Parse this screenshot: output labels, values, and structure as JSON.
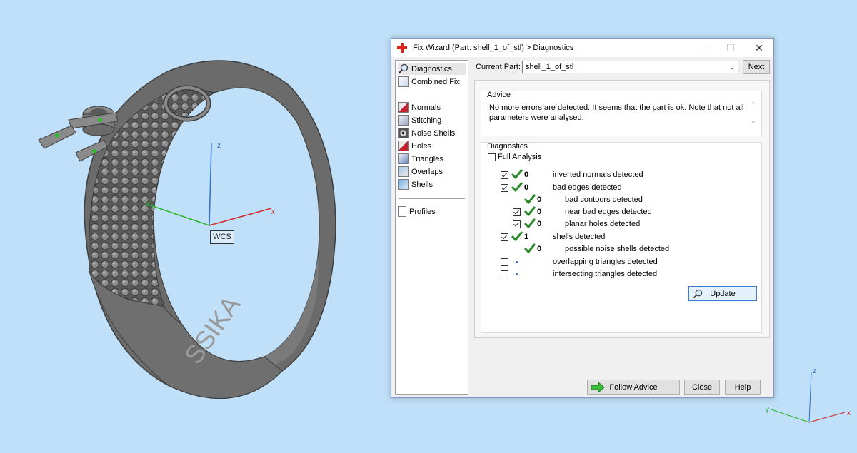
{
  "viewport": {
    "wcs_label": "WCS",
    "axis_x": "x",
    "axis_y": "y",
    "axis_z": "z",
    "corner_axis_z": "z",
    "corner_axis_y": "y",
    "corner_axis_x": "x",
    "ring_engraving": "SSIKA"
  },
  "dialog": {
    "title": "Fix Wizard (Part: shell_1_of_stl) > Diagnostics",
    "sidebar": {
      "items": [
        {
          "label": "Diagnostics",
          "icon": "magnifier-icon"
        },
        {
          "label": "Combined Fix",
          "icon": "cube-icon"
        },
        {
          "label": "Normals",
          "icon": "normals-icon"
        },
        {
          "label": "Stitching",
          "icon": "stitching-icon"
        },
        {
          "label": "Noise Shells",
          "icon": "noise-shells-icon"
        },
        {
          "label": "Holes",
          "icon": "holes-icon"
        },
        {
          "label": "Triangles",
          "icon": "triangles-icon"
        },
        {
          "label": "Overlaps",
          "icon": "overlaps-icon"
        },
        {
          "label": "Shells",
          "icon": "shells-icon"
        },
        {
          "label": "Profiles",
          "icon": "document-icon"
        }
      ]
    },
    "current_part_label": "Current Part:",
    "current_part_value": "shell_1_of_stl",
    "next_label": "Next",
    "advice_title": "Advice",
    "advice_text": "No more errors are detected. It seems that the part is ok. Note that not all parameters were analysed.",
    "diagnostics_title": "Diagnostics",
    "full_analysis_label": "Full Analysis",
    "rows": [
      {
        "checked": true,
        "status": "ok",
        "count": "0",
        "label": "inverted normals detected"
      },
      {
        "checked": true,
        "status": "ok",
        "count": "0",
        "label": "bad edges detected"
      },
      {
        "checked": null,
        "status": "ok",
        "count": "0",
        "label": "bad contours detected"
      },
      {
        "checked": true,
        "status": "ok",
        "count": "0",
        "label": "near bad edges detected"
      },
      {
        "checked": true,
        "status": "ok",
        "count": "0",
        "label": "planar holes detected"
      },
      {
        "checked": true,
        "status": "ok",
        "count": "1",
        "label": "shells detected"
      },
      {
        "checked": null,
        "status": "ok",
        "count": "0",
        "label": "possible noise shells detected"
      },
      {
        "checked": false,
        "status": "pending",
        "count": "",
        "label": "overlapping triangles detected"
      },
      {
        "checked": false,
        "status": "pending",
        "count": "",
        "label": "intersecting triangles detected"
      }
    ],
    "update_label": "Update",
    "follow_advice_label": "Follow Advice",
    "close_label": "Close",
    "help_label": "Help"
  }
}
